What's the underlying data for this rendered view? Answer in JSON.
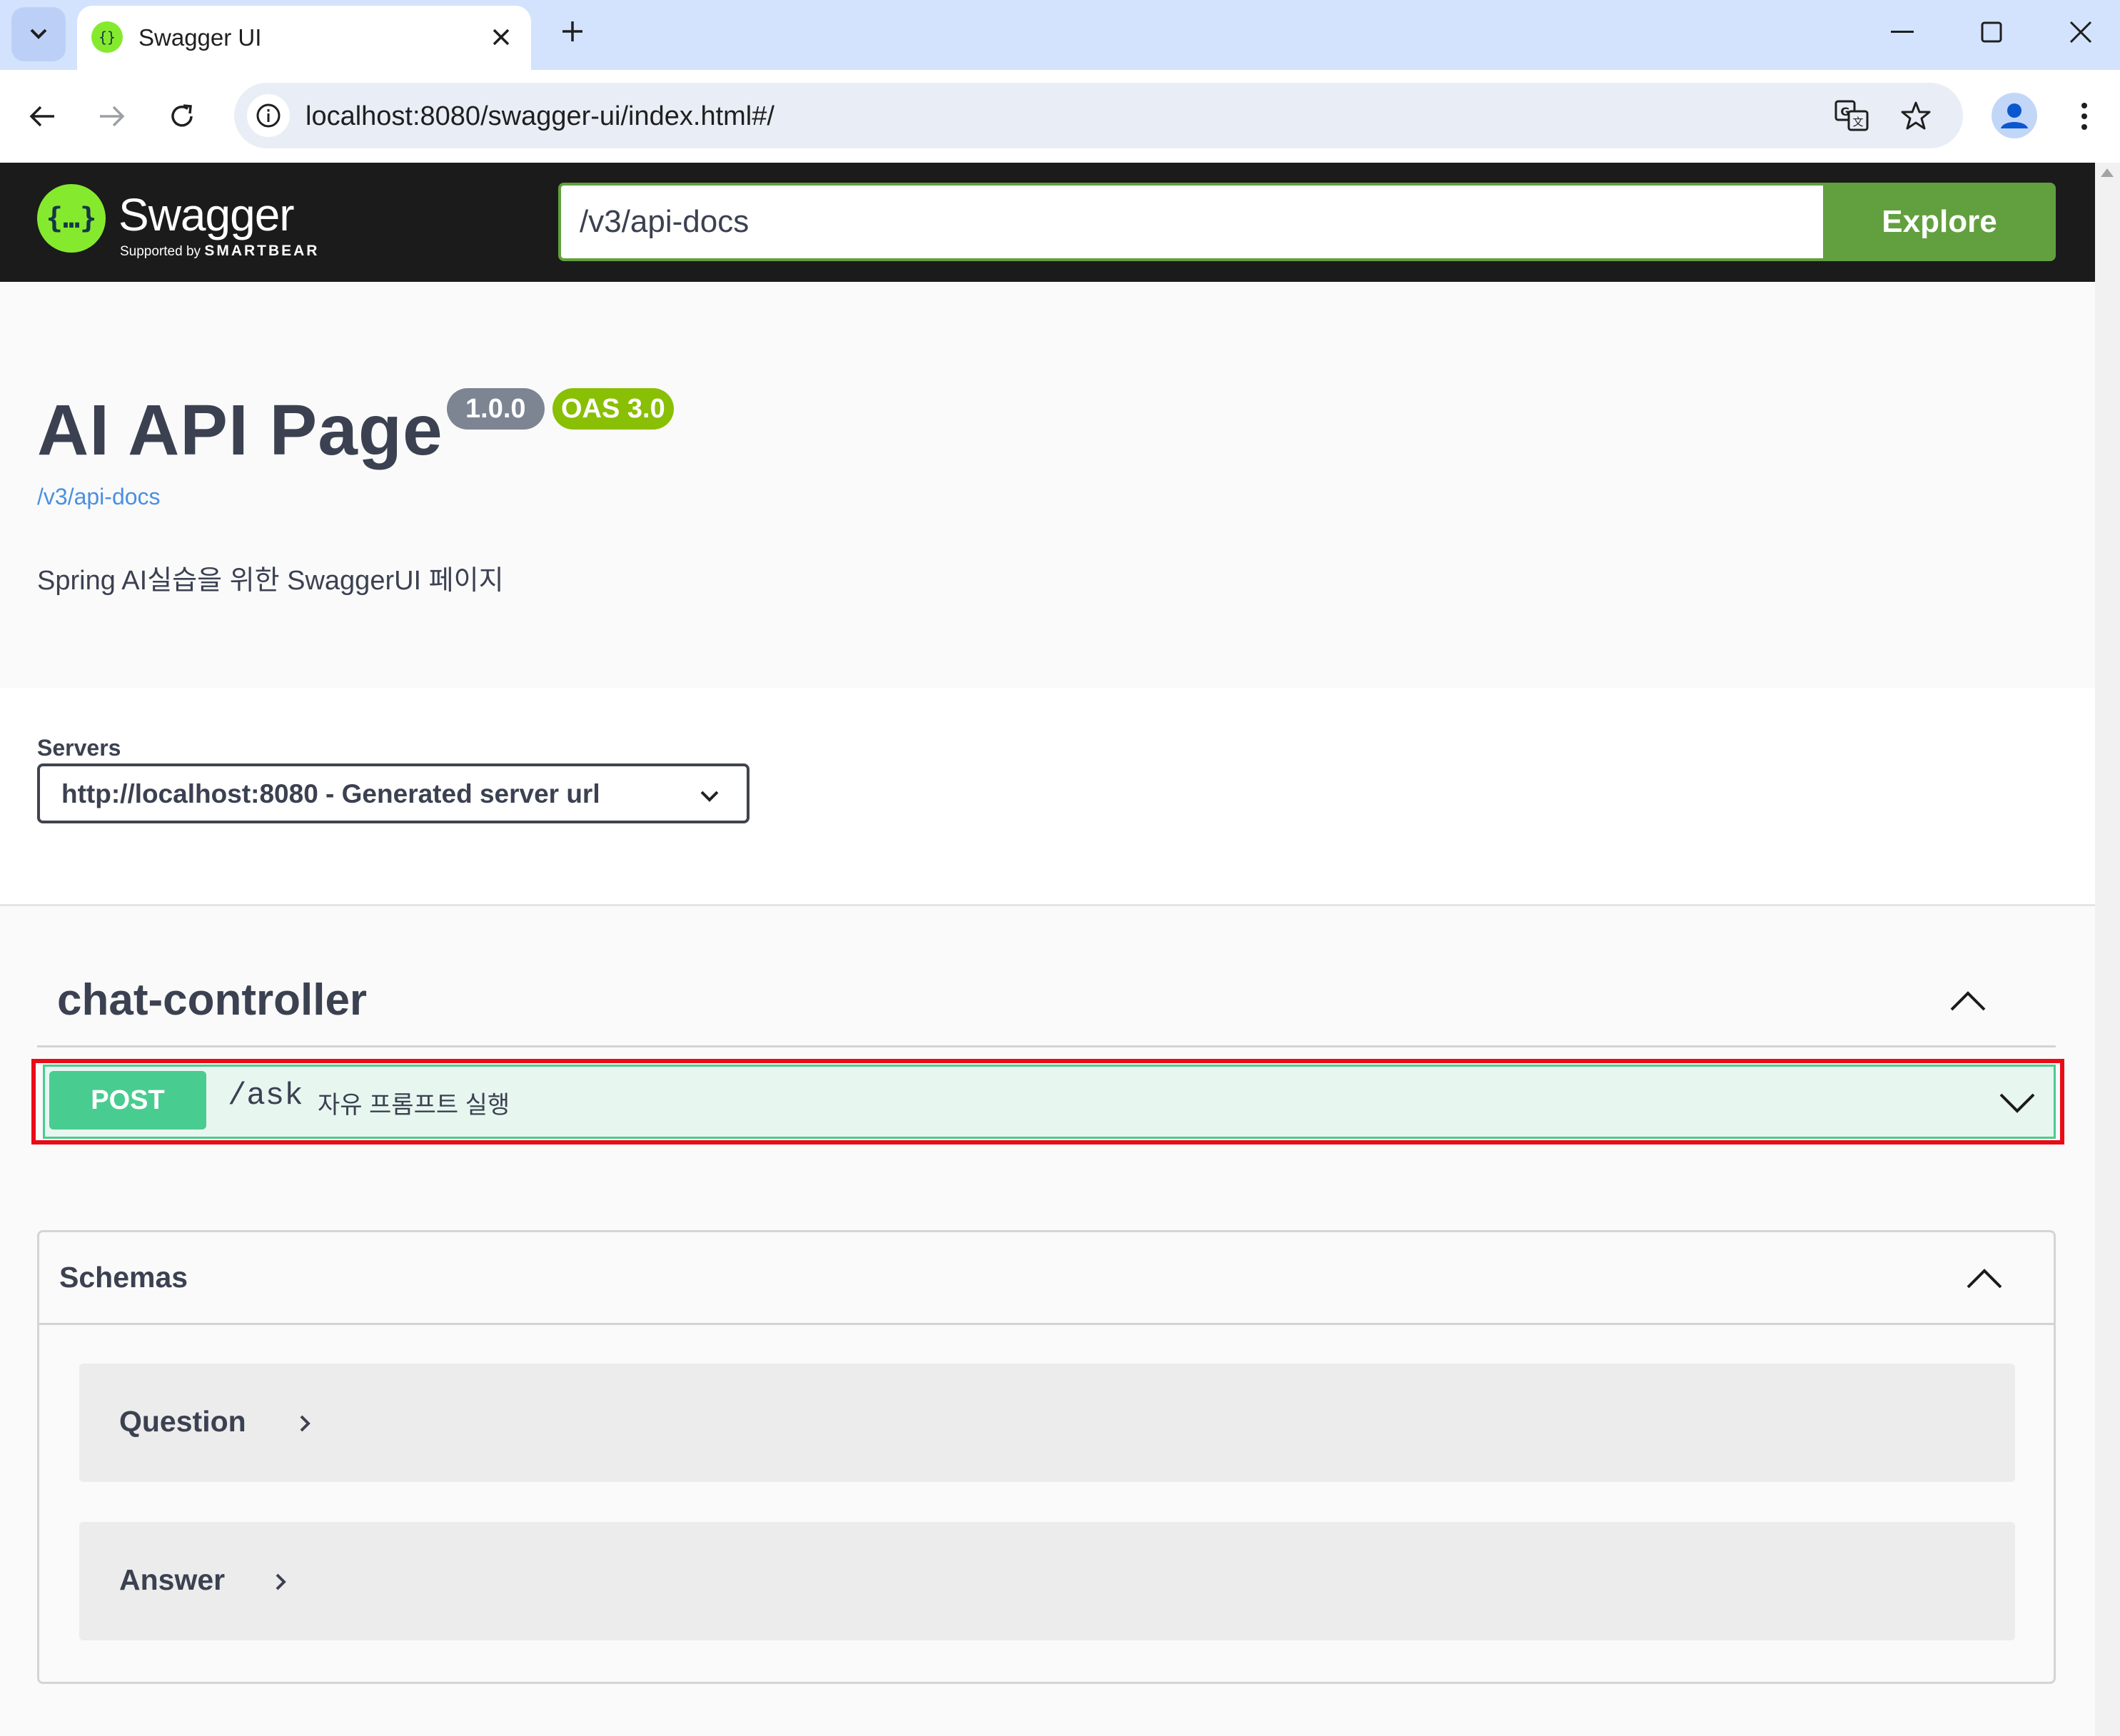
{
  "browser": {
    "tab_title": "Swagger UI",
    "url": "localhost:8080/swagger-ui/index.html#/"
  },
  "topbar": {
    "logo_text": "Swagger",
    "logo_sub_prefix": "Supported by",
    "logo_sub_brand": "SMARTBEAR",
    "url_input_value": "/v3/api-docs",
    "explore_label": "Explore"
  },
  "info": {
    "title": "AI API Page",
    "version": "1.0.0",
    "oas": "OAS 3.0",
    "spec_link": "/v3/api-docs",
    "description": "Spring AI실습을 위한 SwaggerUI 페이지"
  },
  "servers": {
    "label": "Servers",
    "selected": "http://localhost:8080 - Generated server url"
  },
  "tag": {
    "name": "chat-controller",
    "operations": [
      {
        "method": "POST",
        "path": "/ask",
        "summary": "자유 프롬프트 실행"
      }
    ]
  },
  "schemas": {
    "title": "Schemas",
    "models": [
      {
        "name": "Question"
      },
      {
        "name": "Answer"
      }
    ]
  },
  "colors": {
    "topbar_bg": "#1b1b1b",
    "swagger_green": "#85ea2d",
    "explore_green": "#62a03f",
    "post_green": "#49cc90",
    "highlight_red": "#e80c17",
    "version_gray": "#7d8492",
    "oas_green": "#89bf04"
  },
  "icons": [
    "tab-search-icon",
    "swagger-logo-icon",
    "close-icon",
    "plus-icon",
    "minimize-icon",
    "maximize-icon",
    "back-icon",
    "forward-icon",
    "reload-icon",
    "site-info-icon",
    "translate-icon",
    "star-icon",
    "profile-icon",
    "kebab-icon",
    "chevron-down-icon",
    "chevron-up-icon",
    "chevron-right-icon"
  ]
}
